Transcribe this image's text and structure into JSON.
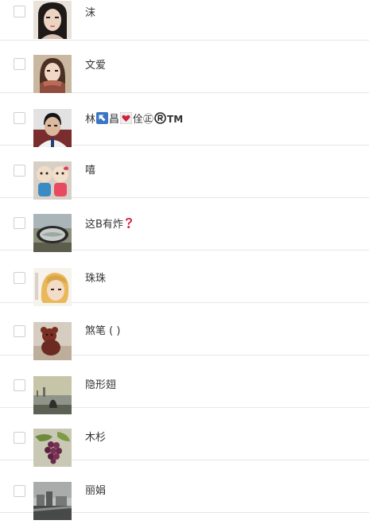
{
  "contacts": [
    {
      "name_parts": [
        "沫"
      ],
      "avatar": "girl-portrait-icon"
    },
    {
      "name_parts": [
        "文爱"
      ],
      "avatar": "girl-scarf-icon"
    },
    {
      "name_parts": [
        "林",
        "昌",
        "佺㊣",
        "TM"
      ],
      "avatar": "boy-portrait-icon",
      "emoji": [
        "arrow-upper-left-emoji",
        "heart-emoji",
        "registered-emoji"
      ]
    },
    {
      "name_parts": [
        "嘻"
      ],
      "avatar": "dolls-icon"
    },
    {
      "name_parts": [
        "这B有炸"
      ],
      "avatar": "car-mirror-icon",
      "emoji": [
        "question-mark-emoji"
      ]
    },
    {
      "name_parts": [
        "珠珠"
      ],
      "avatar": "blonde-girl-icon"
    },
    {
      "name_parts": [
        "煞笔 ( )"
      ],
      "avatar": "teddy-bear-icon"
    },
    {
      "name_parts": [
        "隐形翅"
      ],
      "avatar": "seaside-silhouette-icon"
    },
    {
      "name_parts": [
        "木杉"
      ],
      "avatar": "grapes-icon"
    },
    {
      "name_parts": [
        "丽娟"
      ],
      "avatar": "town-view-icon"
    }
  ],
  "colors": {
    "border": "#e6e6e6",
    "text": "#333333",
    "emoji_red": "#d0223a",
    "emoji_blue": "#3b76c5"
  }
}
